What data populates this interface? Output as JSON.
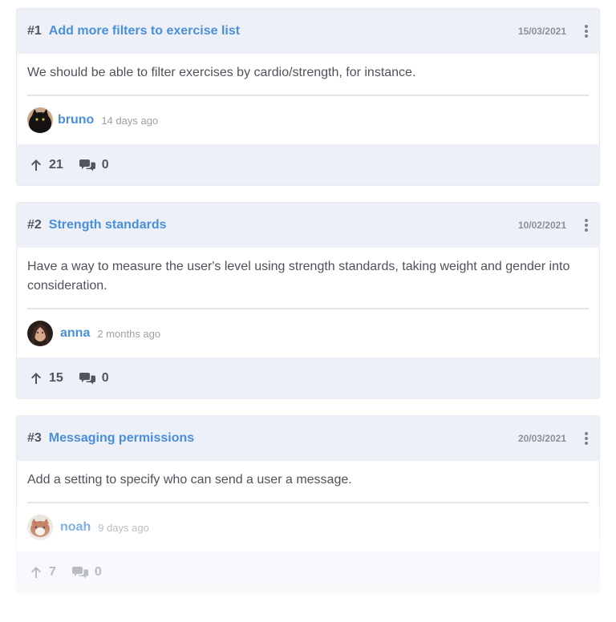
{
  "suggestions": [
    {
      "number": "#1",
      "title": "Add more filters to exercise list",
      "date": "15/03/2021",
      "description": "We should be able to filter exercises by cardio/strength, for instance.",
      "author": "bruno",
      "time_ago": "14 days ago",
      "upvotes": "21",
      "comments": "0"
    },
    {
      "number": "#2",
      "title": "Strength standards",
      "date": "10/02/2021",
      "description": "Have a way to measure the user's level using strength standards, taking weight and gender into consideration.",
      "author": "anna",
      "time_ago": "2 months ago",
      "upvotes": "15",
      "comments": "0"
    },
    {
      "number": "#3",
      "title": "Messaging permissions",
      "date": "20/03/2021",
      "description": "Add a setting to specify who can send a user a message.",
      "author": "noah",
      "time_ago": "9 days ago",
      "upvotes": "7",
      "comments": "0"
    }
  ],
  "icons": {
    "upvote": "arrow-up-icon",
    "comments": "comments-icon",
    "more": "kebab-menu-icon"
  },
  "colors": {
    "accent": "#4a8fda",
    "header_bg": "#edf0f7",
    "text": "#4d525a",
    "muted": "#9ba0a8"
  }
}
